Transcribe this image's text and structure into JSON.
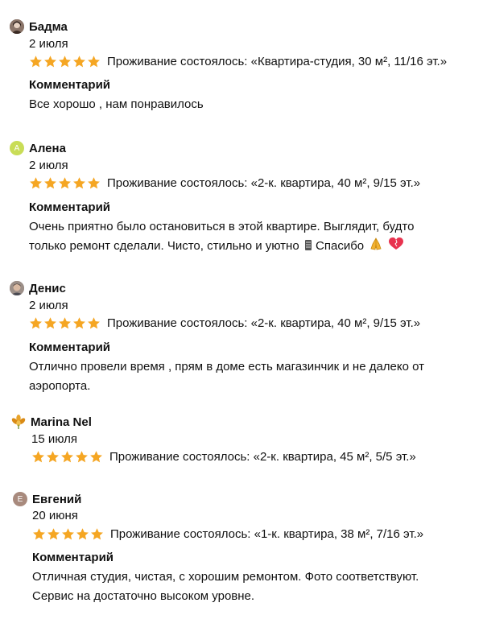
{
  "colors": {
    "star": "#f5a623",
    "text": "#111111",
    "avatar_alena": "#c9dd57",
    "avatar_evgeniy": "#a88a7d"
  },
  "reviews": [
    {
      "author": "Бадма",
      "avatar_icon": "person-photo-avatar",
      "date": "2 июля",
      "rating": 5,
      "stay": "Проживание состоялось: «Квартира-студия, 30 м², 11/16 эт.»",
      "comment_label": "Комментарий",
      "comment_lines": [
        "Все хорошо , нам понравилось"
      ]
    },
    {
      "author": "Алена",
      "avatar_letter": "А",
      "date": "2 июля",
      "rating": 5,
      "stay": "Проживание состоялось: «2-к. квартира, 40 м², 9/15 эт.»",
      "comment_label": "Комментарий",
      "comment_lines": [
        "Очень приятно было остановиться в этой квартире. Выглядит, будто",
        "только ремонт сделали. Чисто, стильно и уютно",
        "Спасибо"
      ],
      "emoji_icons": [
        "sparkle-icon",
        "praying-hands-icon",
        "heart-icon"
      ]
    },
    {
      "author": "Денис",
      "avatar_icon": "person-photo-avatar",
      "date": "2 июля",
      "rating": 5,
      "stay": "Проживание состоялось: «2-к. квартира, 40 м², 9/15 эт.»",
      "comment_label": "Комментарий",
      "comment_lines": [
        "Отлично провели время , прям в доме есть магазинчик и не далеко от",
        "аэропорта."
      ]
    },
    {
      "author": "Marina Nel",
      "avatar_icon": "flower-avatar",
      "date": "15 июля",
      "rating": 5,
      "stay": "Проживание состоялось: «2-к. квартира, 45 м², 5/5 эт.»"
    },
    {
      "author": "Евгений",
      "avatar_letter": "Е",
      "date": "20 июня",
      "rating": 5,
      "stay": "Проживание состоялось: «1-к. квартира, 38 м², 7/16 эт.»",
      "comment_label": "Комментарий",
      "comment_lines": [
        "Отличная студия, чистая, с хорошим ремонтом. Фото соответствуют.",
        "Сервис на достаточно высоком уровне."
      ]
    }
  ]
}
